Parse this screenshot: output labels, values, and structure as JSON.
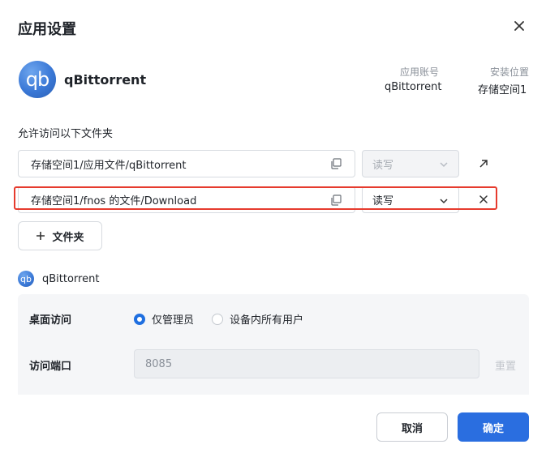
{
  "dialog": {
    "title": "应用设置",
    "close_icon": "close-icon"
  },
  "app": {
    "icon_text": "qb",
    "name": "qBittorrent",
    "account_label": "应用账号",
    "account_value": "qBittorrent",
    "location_label": "安装位置",
    "location_value": "存储空间1"
  },
  "folders": {
    "section_label": "允许访问以下文件夹",
    "rows": [
      {
        "path": "存储空间1/应用文件/qBittorrent",
        "permission": "读写",
        "action_icon": "external-link-icon"
      },
      {
        "path": "存储空间1/fnos 的文件/Download",
        "permission": "读写",
        "action_icon": "close-icon"
      }
    ],
    "add_label": "文件夹"
  },
  "access": {
    "icon_text": "qb",
    "app_name": "qBittorrent",
    "desktop_label": "桌面访问",
    "radio_admin": "仅管理员",
    "radio_all": "设备内所有用户",
    "selected": "仅管理员",
    "port_label": "访问端口",
    "port_value": "8085",
    "reset_label": "重置"
  },
  "footer": {
    "cancel": "取消",
    "confirm": "确定"
  },
  "colors": {
    "accent": "#2a6ee0",
    "highlight": "#e63b2e"
  }
}
